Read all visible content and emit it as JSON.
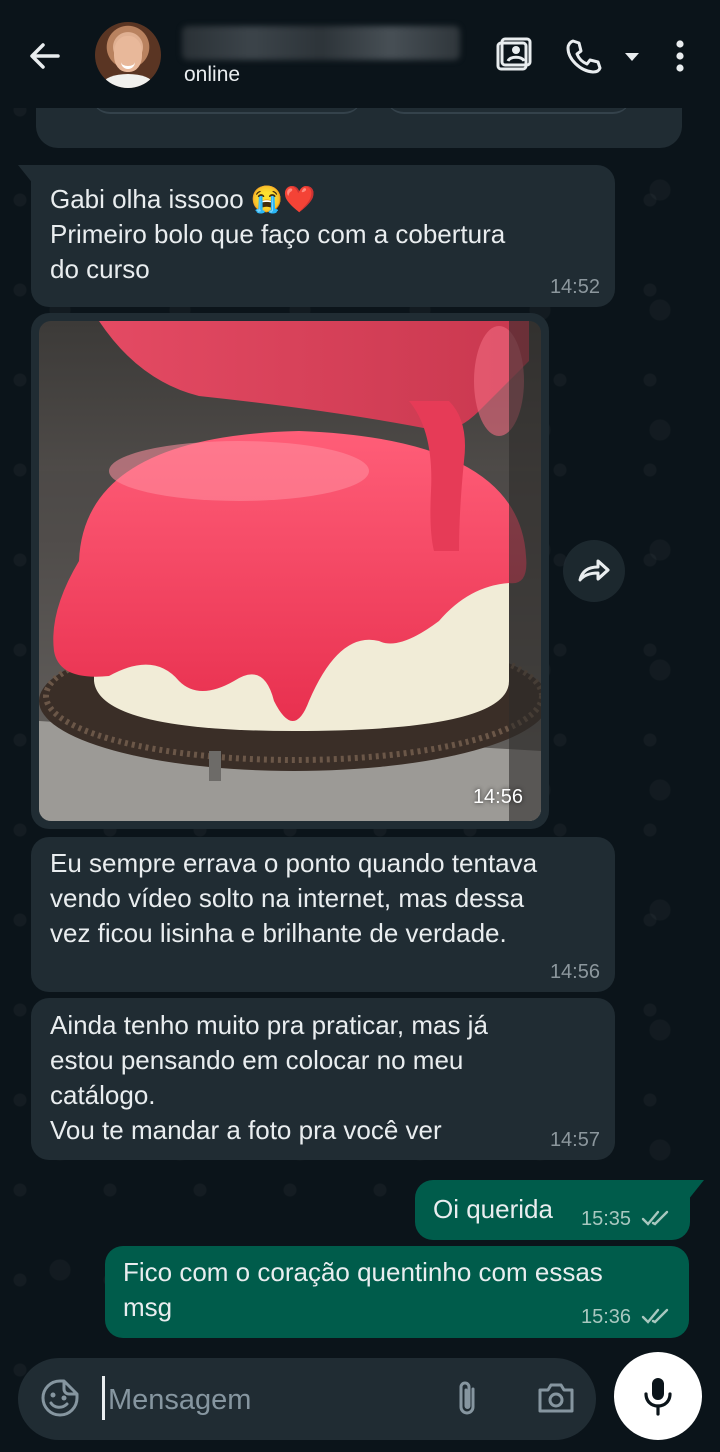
{
  "header": {
    "contact_status": "online"
  },
  "messages": [
    {
      "direction": "in",
      "text": "Gabi olha issooo 😭❤️\nPrimeiro bolo que faço com a cobertura\ndo curso",
      "time": "14:52"
    },
    {
      "direction": "in",
      "type": "image",
      "time": "14:56"
    },
    {
      "direction": "in",
      "text": "Eu sempre errava o ponto quando tentava\nvendo vídeo solto na internet, mas dessa\nvez ficou lisinha e brilhante de verdade.",
      "time": "14:56"
    },
    {
      "direction": "in",
      "text": "Ainda tenho muito pra praticar, mas já\nestou pensando em colocar no meu\ncatálogo.\nVou te mandar a foto pra você ver",
      "time": "14:57"
    },
    {
      "direction": "out",
      "text": "Oi querida",
      "time": "15:35",
      "status": "read"
    },
    {
      "direction": "out",
      "text": "Fico com o coração quentinho com essas\nmsg",
      "time": "15:36",
      "status": "read"
    }
  ],
  "composer": {
    "placeholder": "Mensagem"
  },
  "icons": {
    "back": "arrow-left-icon",
    "video": "video-call-icon",
    "phone": "phone-icon",
    "dropdown": "caret-down-icon",
    "menu": "more-vertical-icon",
    "forward": "forward-icon",
    "emoji": "emoji-sticker-icon",
    "attach": "paperclip-icon",
    "camera": "camera-icon",
    "mic": "microphone-icon"
  },
  "colors": {
    "background": "#0b141a",
    "incoming_bubble": "#202c33",
    "outgoing_bubble": "#005c4b",
    "read_ticks": "#a8c7bf"
  }
}
